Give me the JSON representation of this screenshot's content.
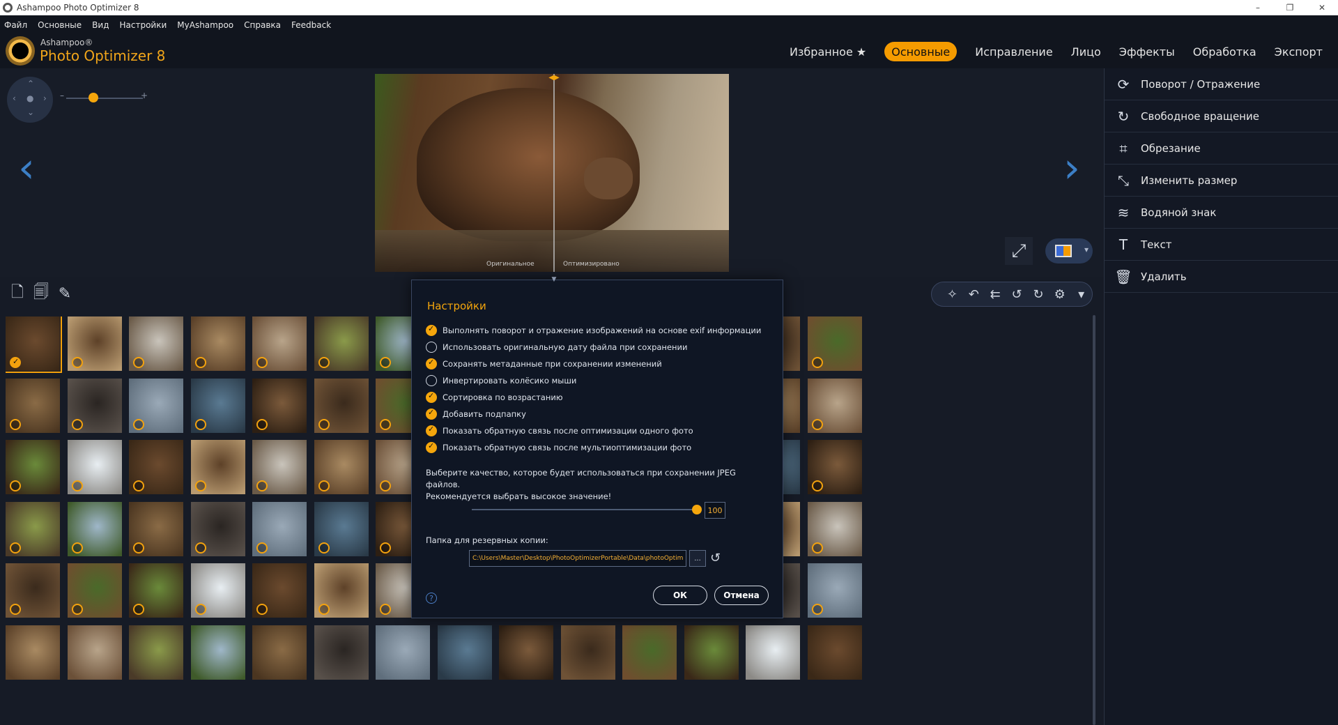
{
  "window": {
    "title": "Ashampoo Photo Optimizer 8"
  },
  "menu": [
    "Файл",
    "Основные",
    "Вид",
    "Настройки",
    "MyAshampoo",
    "Справка",
    "Feedback"
  ],
  "brand": {
    "line1": "Ashampoo®",
    "line2": "Photo Optimizer 8",
    "accent": "#f59b00"
  },
  "tabs": [
    {
      "label": "Избранное ★",
      "active": false
    },
    {
      "label": "Основные",
      "active": true
    },
    {
      "label": "Исправление",
      "active": false
    },
    {
      "label": "Лицо",
      "active": false
    },
    {
      "label": "Эффекты",
      "active": false
    },
    {
      "label": "Обработка",
      "active": false
    },
    {
      "label": "Экспорт",
      "active": false
    }
  ],
  "preview": {
    "label_original": "Оригинальное",
    "label_optimized": "Оптимизировано"
  },
  "right_panel": [
    {
      "label": "Поворот / Отражение",
      "icon": "rotate-icon"
    },
    {
      "label": "Свободное вращение",
      "icon": "free-rotate-icon"
    },
    {
      "label": "Обрезание",
      "icon": "crop-icon"
    },
    {
      "label": "Изменить размер",
      "icon": "resize-icon"
    },
    {
      "label": "Водяной знак",
      "icon": "watermark-icon"
    },
    {
      "label": "Текст",
      "icon": "text-icon"
    },
    {
      "label": "Удалить",
      "icon": "trash-icon"
    }
  ],
  "dialog": {
    "title": "Настройки",
    "options": [
      {
        "label": "Выполнять поворот и отражение изображений на основе exif информации",
        "checked": true
      },
      {
        "label": "Использовать оригинальную дату файла при сохранении",
        "checked": false
      },
      {
        "label": "Сохранять метаданные при сохранении изменений",
        "checked": true
      },
      {
        "label": "Инвертировать колёсико мыши",
        "checked": false
      },
      {
        "label": "Сортировка по возрастанию",
        "checked": true
      },
      {
        "label": "Добавить подпапку",
        "checked": true
      },
      {
        "label": "Показать обратную связь после оптимизации одного фото",
        "checked": true
      },
      {
        "label": "Показать обратную связь после мультиоптимизации фото",
        "checked": true
      }
    ],
    "quality_text_1": "Выберите качество, которое будет использоваться при сохранении JPEG файлов.",
    "quality_text_2": "Рекомендуется выбрать высокое значение!",
    "quality_value": "100",
    "backup_label": "Папка для резервных копии:",
    "backup_path": "C:\\Users\\Master\\Desktop\\PhotoOptimizerPortable\\Data\\photoOptimizeHis",
    "browse_label": "...",
    "ok_label": "ОК",
    "cancel_label": "Отмена"
  }
}
